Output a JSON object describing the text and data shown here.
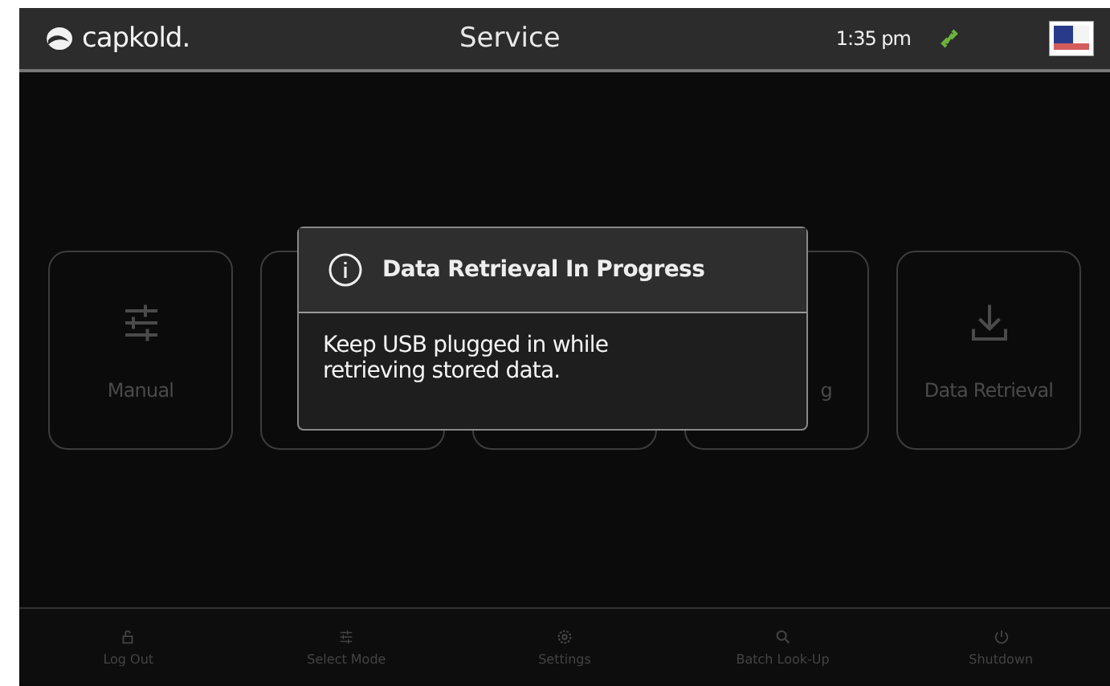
{
  "top_bar": {
    "logo": "capkold.",
    "title": "Service",
    "time": "1:35 pm"
  },
  "tiles": [
    {
      "kind": "manual",
      "label": "Manual"
    },
    {
      "kind": "hidden"
    },
    {
      "kind": "hidden"
    },
    {
      "kind": "hidden",
      "label": "g"
    },
    {
      "kind": "download",
      "label": "Data Retrieval"
    }
  ],
  "dialog": {
    "title": "Data Retrieval In Progress",
    "message": "Keep USB plugged in while retrieving stored data."
  },
  "bottom_nav": [
    {
      "kind": "lock",
      "label": "Log Out"
    },
    {
      "kind": "sliders",
      "label": "Select Mode"
    },
    {
      "kind": "gear",
      "label": "Settings"
    },
    {
      "kind": "search",
      "label": "Batch Look-Up"
    },
    {
      "kind": "power",
      "label": "Shutdown"
    }
  ]
}
